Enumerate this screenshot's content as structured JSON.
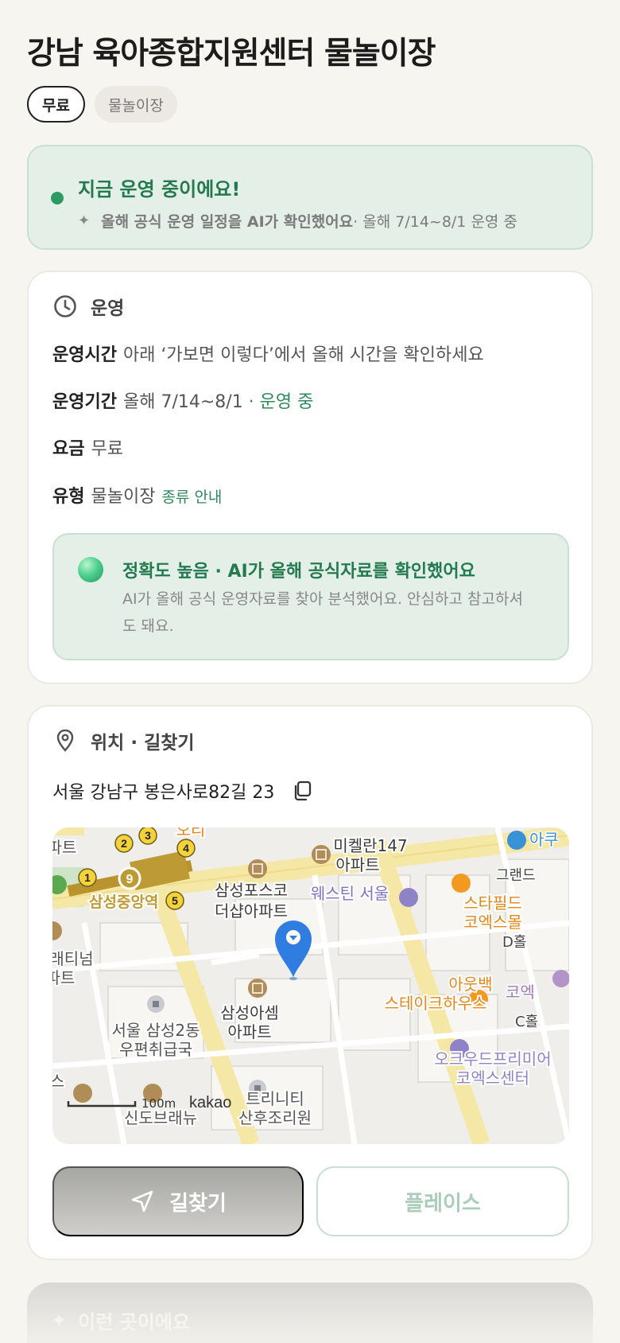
{
  "title": "강남 육아종합지원센터 물놀이장",
  "chips": {
    "price": "무료",
    "type": "물놀이장"
  },
  "status": {
    "headline": "지금 운영 중이에요!",
    "ai_note": "올해 공식 운영 일정을 AI가 확인했어요",
    "period_note": " · 올해 7/14~8/1 운영 중",
    "accent": "#2e9b65"
  },
  "operation": {
    "section_label": "운영",
    "rows": {
      "hours_key": "운영시간",
      "hours_value": "아래 ‘가보면 이렇다’에서 올해 시간을 확인하세요",
      "period_key": "운영기간",
      "period_value": "올해 7/14~8/1",
      "period_status": " · 운영 중",
      "fee_key": "요금",
      "fee_value": "무료",
      "type_key": "유형",
      "type_value": "물놀이장",
      "type_link": "종류 안내"
    },
    "accuracy": {
      "title": "정확도 높음 · AI가 올해 공식자료를 확인했어요",
      "desc": "AI가 올해 공식 운영자료를 찾아 분석했어요. 안심하고 참고하셔도 돼요."
    }
  },
  "location": {
    "section_label": "위치 · 길찾기",
    "address": "서울 강남구 봉은사로82길 23",
    "map_labels": {
      "station": "삼성중앙역",
      "line_badge": "9",
      "apt1": "삼성포스코",
      "apt1b": "더샵아파트",
      "apt2": "삼성아셈",
      "apt2b": "아파트",
      "apt3": "미켈란147",
      "apt3b": "아파트",
      "hotel": "웨스틴 서울",
      "mall": "스타필드",
      "mallb": "코엑스몰",
      "restaurant": "아웃백",
      "restaurantb": "스테이크하우스",
      "post": "서울 삼성2동",
      "postb": "우편취급국",
      "residence": "오크우드프리미어",
      "residenceb": "코엑스센터",
      "platinum": "래티넘",
      "platinumb": "파트",
      "trinity": "트리니티",
      "trinityb": "산후조리원",
      "shindo": "신도브래뉴",
      "grand": "그랜드",
      "dhall": "D홀",
      "chall": "C홀",
      "coex": "코엑",
      "aqua": "아쿠",
      "bank": "오리",
      "apt_top": "파트",
      "se": "스",
      "scale": "100m",
      "logo": "kakao",
      "exits": [
        "1",
        "2",
        "3",
        "4",
        "5"
      ]
    },
    "directions_button": "길찾기",
    "place_button": "플레이스"
  },
  "next_section": {
    "label": "이런 곳이에요"
  },
  "icons": {
    "clock": "clock-icon",
    "pin": "map-pin-icon",
    "copy": "copy-icon",
    "nav": "navigation-arrow-icon",
    "sparkle": "sparkle-icon",
    "marker": "map-marker-icon"
  }
}
